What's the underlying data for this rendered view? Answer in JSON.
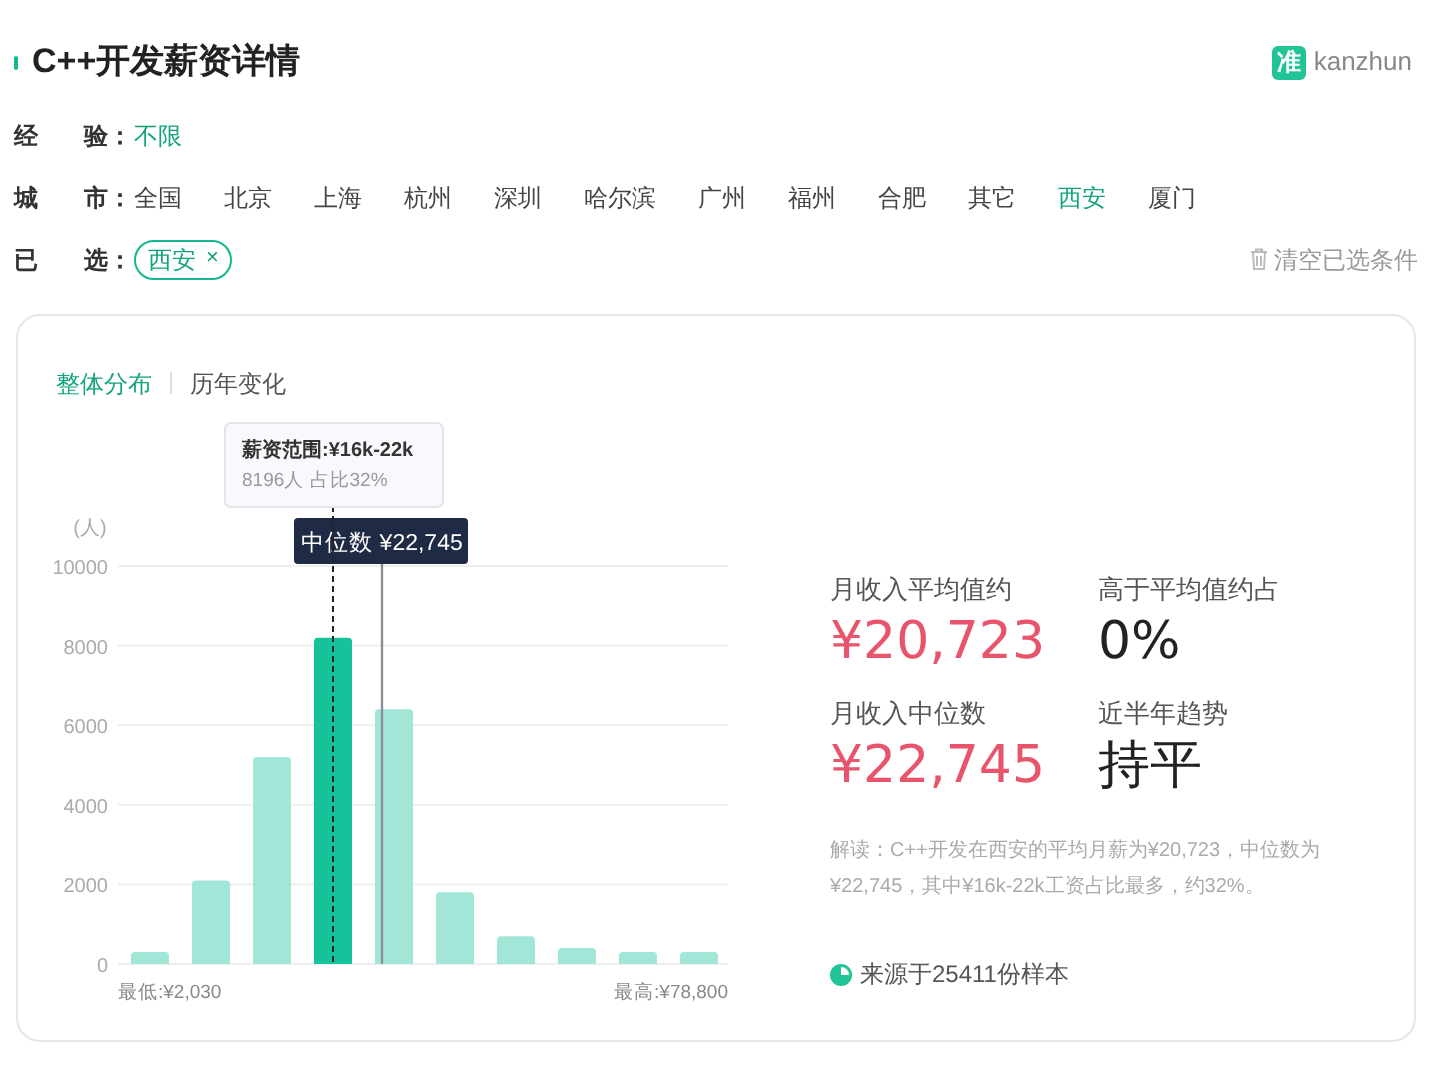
{
  "title": "C++开发薪资详情",
  "brand": {
    "badge": "准",
    "name": "kanzhun"
  },
  "filters": [
    {
      "kind": "options",
      "label": [
        "经",
        "验："
      ],
      "options": [
        {
          "label": "不限",
          "selected": true
        }
      ]
    },
    {
      "kind": "options",
      "label": [
        "城",
        "市："
      ],
      "options": [
        {
          "label": "全国",
          "selected": false
        },
        {
          "label": "北京",
          "selected": false
        },
        {
          "label": "上海",
          "selected": false
        },
        {
          "label": "杭州",
          "selected": false
        },
        {
          "label": "深圳",
          "selected": false
        },
        {
          "label": "哈尔滨",
          "selected": false
        },
        {
          "label": "广州",
          "selected": false
        },
        {
          "label": "福州",
          "selected": false
        },
        {
          "label": "合肥",
          "selected": false
        },
        {
          "label": "其它",
          "selected": false
        },
        {
          "label": "西安",
          "selected": true
        },
        {
          "label": "厦门",
          "selected": false
        }
      ]
    },
    {
      "kind": "chips",
      "label": [
        "已",
        "选："
      ],
      "chips": [
        {
          "label": "西安",
          "remove": "×"
        }
      ],
      "clear": "清空已选条件"
    }
  ],
  "tabs": [
    {
      "label": "整体分布",
      "selected": true
    },
    {
      "label": "历年变化",
      "selected": false
    }
  ],
  "chart": {
    "tooltip": {
      "title": "薪资范围:¥16k-22k",
      "text": "8196人  占比32%"
    },
    "median_label": "中位数 ¥22,745",
    "min_label": "最低:¥2,030",
    "max_label": "最高:¥78,800",
    "chart_data": {
      "type": "bar",
      "ylabel": "(人)",
      "ylim": [
        0,
        10000
      ],
      "yticks": [
        0,
        2000,
        4000,
        6000,
        8000,
        10000
      ],
      "grid": true,
      "values": [
        300,
        2100,
        5200,
        8200,
        6400,
        1800,
        700,
        400,
        300,
        300
      ]
    }
  },
  "stats": [
    {
      "label": "月收入平均值约",
      "value": "¥20,723",
      "accent": true
    },
    {
      "label": "高于平均值约占",
      "value": "0%",
      "accent": false
    },
    {
      "label": "月收入中位数",
      "value": "¥22,745",
      "accent": true
    },
    {
      "label": "近半年趋势",
      "value": "持平",
      "accent": false
    }
  ],
  "interpretation": "解读：C++开发在西安的平均月薪为¥20,723，中位数为¥22,745，其中¥16k-22k工资占比最多，约32%。",
  "source": "来源于25411份样本"
}
